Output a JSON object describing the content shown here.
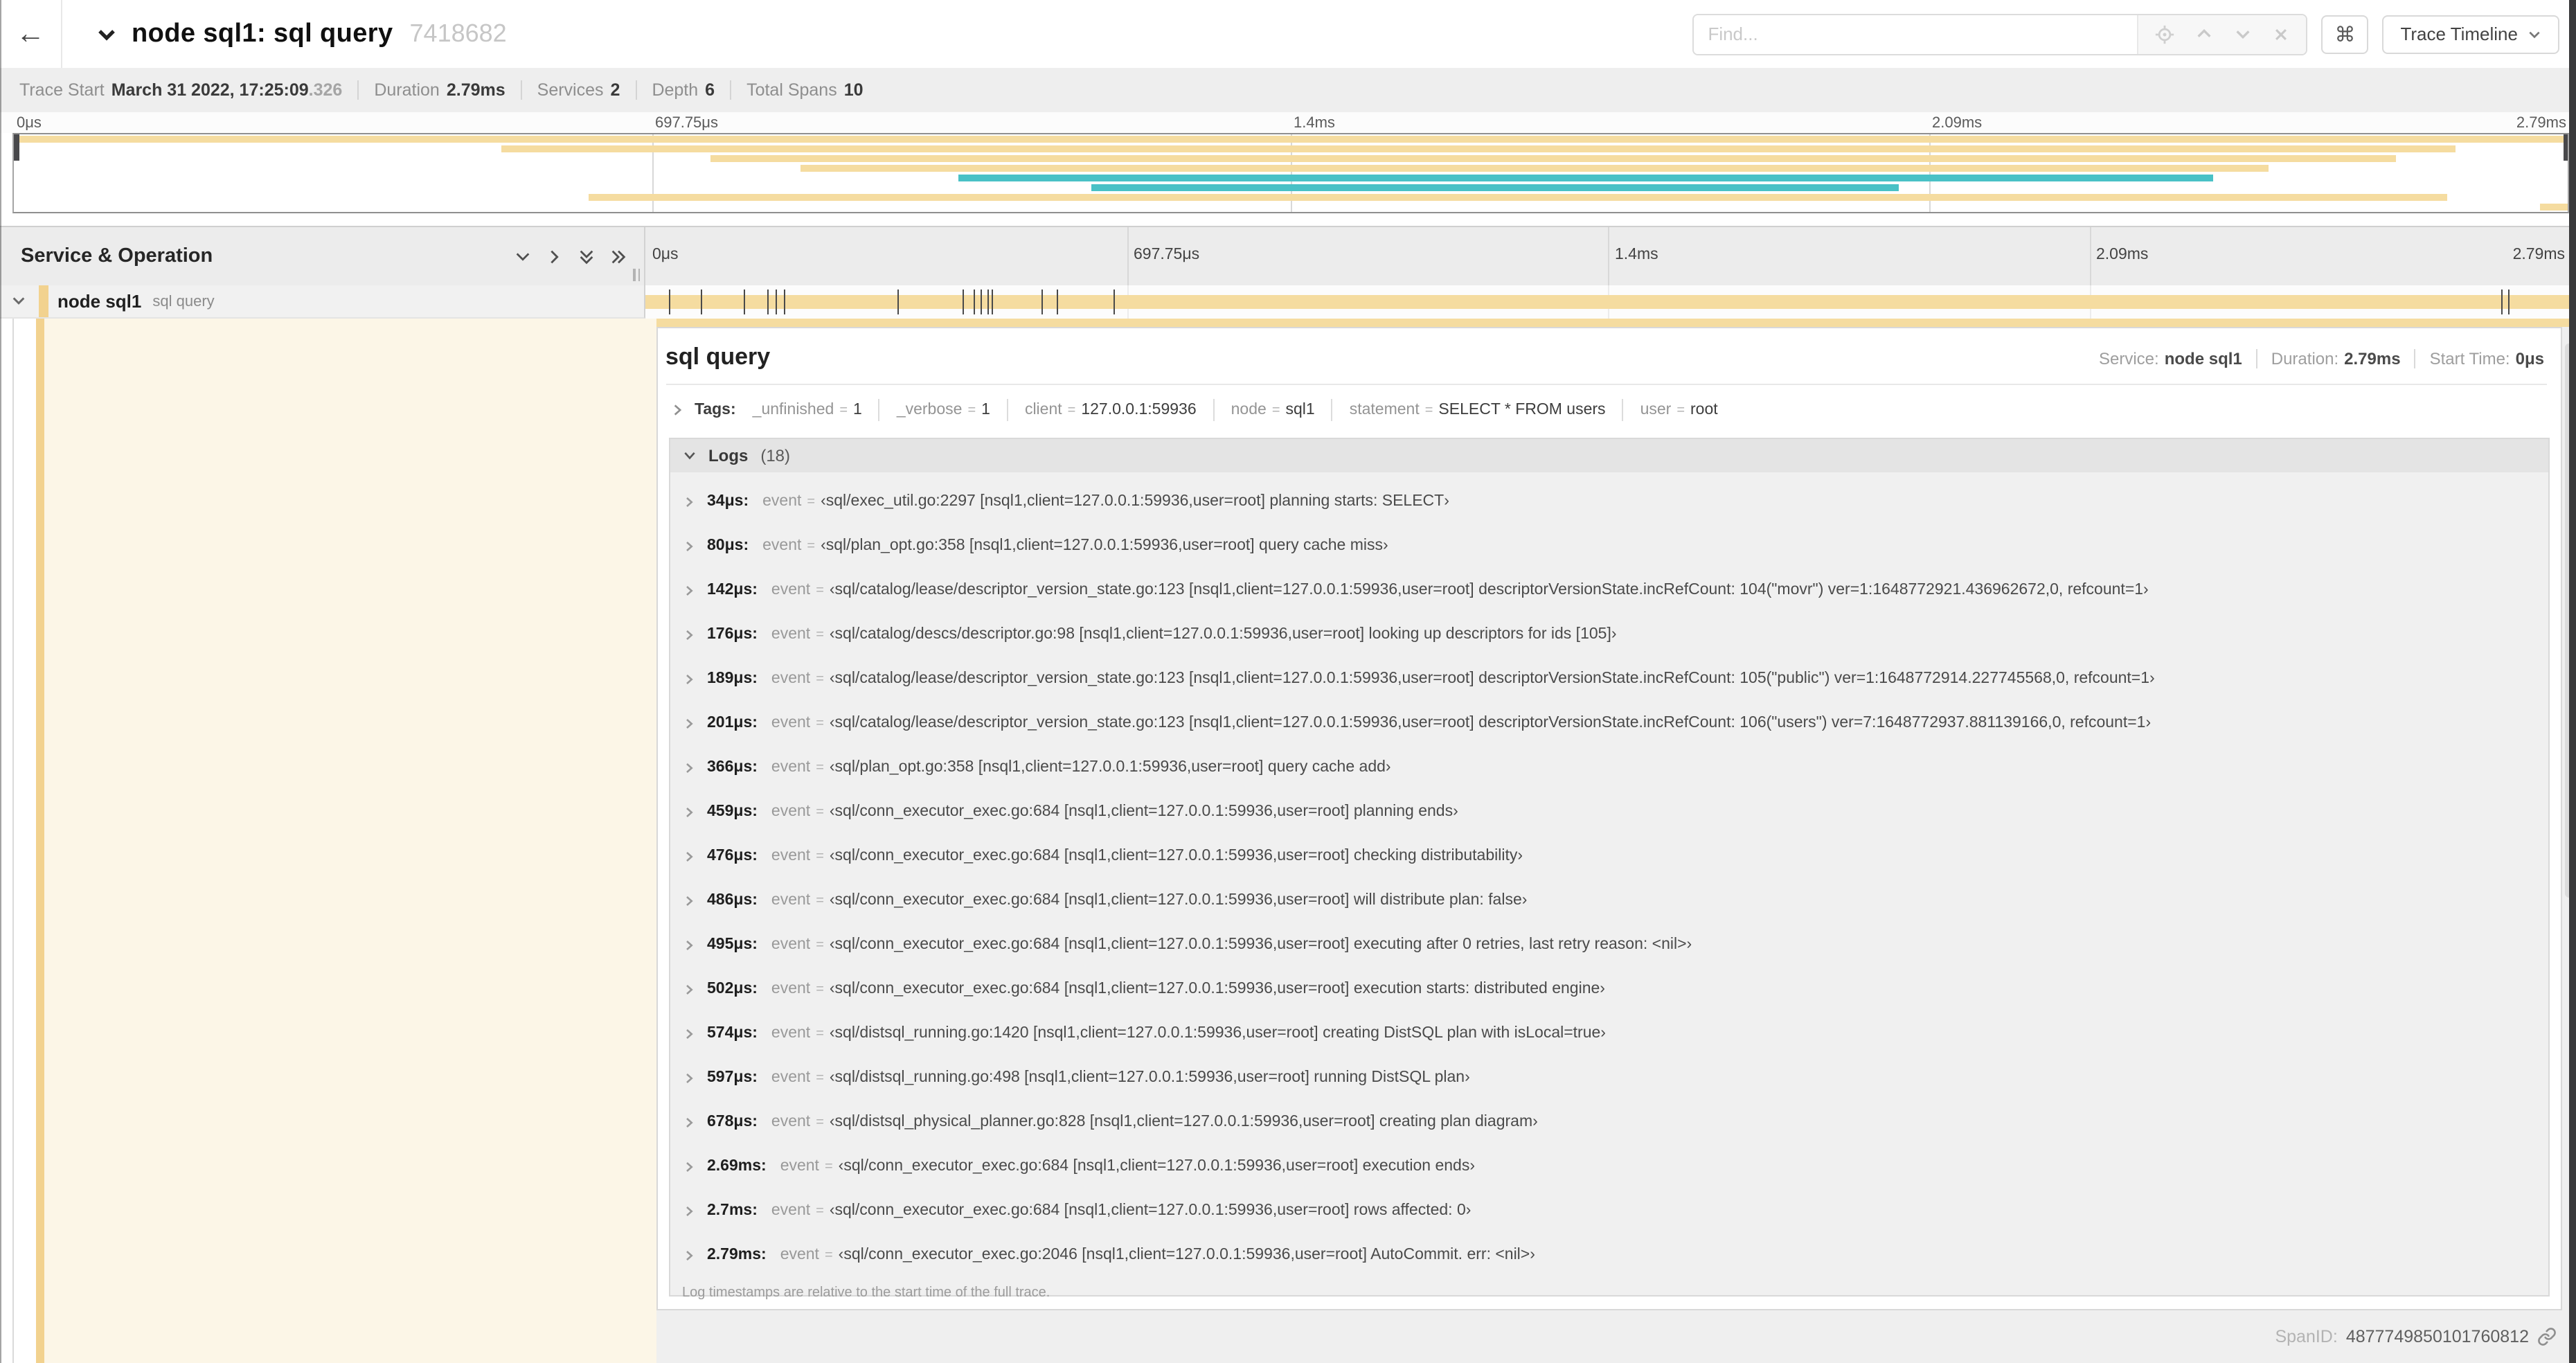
{
  "header": {
    "back_icon": "←",
    "title": "node sql1: sql query",
    "trace_id": "7418682",
    "find_placeholder": "Find...",
    "command_icon": "⌘",
    "view_dropdown": "Trace Timeline"
  },
  "trace_meta": {
    "items": [
      {
        "label": "Trace Start",
        "value": "March 31 2022, 17:25:09",
        "dim": ".326"
      },
      {
        "label": "Duration",
        "value": "2.79ms",
        "dim": ""
      },
      {
        "label": "Services",
        "value": "2",
        "dim": ""
      },
      {
        "label": "Depth",
        "value": "6",
        "dim": ""
      },
      {
        "label": "Total Spans",
        "value": "10",
        "dim": ""
      }
    ]
  },
  "minimap": {
    "ruler_labels": [
      "0μs",
      "697.75μs",
      "1.4ms",
      "2.09ms",
      "2.79ms"
    ],
    "spans": [
      {
        "row": 0,
        "start": 0,
        "end": 100,
        "color": "tan"
      },
      {
        "row": 1,
        "start": 19.1,
        "end": 95.6,
        "color": "tan"
      },
      {
        "row": 2,
        "start": 27.3,
        "end": 93.3,
        "color": "tan"
      },
      {
        "row": 3,
        "start": 30.8,
        "end": 88.3,
        "color": "tan"
      },
      {
        "row": 4,
        "start": 37.0,
        "end": 86.1,
        "color": "teal"
      },
      {
        "row": 5,
        "start": 42.2,
        "end": 73.8,
        "color": "teal"
      },
      {
        "row": 6,
        "start": 22.5,
        "end": 95.3,
        "color": "tan"
      },
      {
        "row": 7,
        "start": 98.9,
        "end": 100,
        "color": "tan"
      }
    ]
  },
  "timeline": {
    "left_header": "Service & Operation",
    "ruler_labels": [
      "0μs",
      "697.75μs",
      "1.4ms",
      "2.09ms",
      "2.79ms"
    ],
    "row": {
      "service": "node sql1",
      "operation": "sql query"
    },
    "duration_us": 2790,
    "tick_times_us": [
      34,
      80,
      142,
      176,
      189,
      201,
      366,
      459,
      476,
      486,
      495,
      502,
      574,
      597,
      678,
      2690,
      2700
    ]
  },
  "detail": {
    "title": "sql query",
    "stats": [
      {
        "label": "Service:",
        "value": "node sql1"
      },
      {
        "label": "Duration:",
        "value": "2.79ms"
      },
      {
        "label": "Start Time:",
        "value": "0μs"
      }
    ],
    "tags_label": "Tags:",
    "tags": [
      {
        "key": "_unfinished",
        "eq": "=",
        "value": "1"
      },
      {
        "key": "_verbose",
        "eq": "=",
        "value": "1"
      },
      {
        "key": "client",
        "eq": "=",
        "value": "127.0.0.1:59936"
      },
      {
        "key": "node",
        "eq": "=",
        "value": "sql1"
      },
      {
        "key": "statement",
        "eq": "=",
        "value": "SELECT * FROM users"
      },
      {
        "key": "user",
        "eq": "=",
        "value": "root"
      }
    ],
    "logs_title": "Logs",
    "logs_count": "(18)",
    "logs": [
      {
        "t": "34μs:",
        "k": "event",
        "eq": "=",
        "v": "‹sql/exec_util.go:2297 [nsql1,client=127.0.0.1:59936,user=root] planning starts: SELECT›"
      },
      {
        "t": "80μs:",
        "k": "event",
        "eq": "=",
        "v": "‹sql/plan_opt.go:358 [nsql1,client=127.0.0.1:59936,user=root] query cache miss›"
      },
      {
        "t": "142μs:",
        "k": "event",
        "eq": "=",
        "v": "‹sql/catalog/lease/descriptor_version_state.go:123 [nsql1,client=127.0.0.1:59936,user=root] descriptorVersionState.incRefCount: 104(\"movr\") ver=1:1648772921.436962672,0, refcount=1›"
      },
      {
        "t": "176μs:",
        "k": "event",
        "eq": "=",
        "v": "‹sql/catalog/descs/descriptor.go:98 [nsql1,client=127.0.0.1:59936,user=root] looking up descriptors for ids [105]›"
      },
      {
        "t": "189μs:",
        "k": "event",
        "eq": "=",
        "v": "‹sql/catalog/lease/descriptor_version_state.go:123 [nsql1,client=127.0.0.1:59936,user=root] descriptorVersionState.incRefCount: 105(\"public\") ver=1:1648772914.227745568,0, refcount=1›"
      },
      {
        "t": "201μs:",
        "k": "event",
        "eq": "=",
        "v": "‹sql/catalog/lease/descriptor_version_state.go:123 [nsql1,client=127.0.0.1:59936,user=root] descriptorVersionState.incRefCount: 106(\"users\") ver=7:1648772937.881139166,0, refcount=1›"
      },
      {
        "t": "366μs:",
        "k": "event",
        "eq": "=",
        "v": "‹sql/plan_opt.go:358 [nsql1,client=127.0.0.1:59936,user=root] query cache add›"
      },
      {
        "t": "459μs:",
        "k": "event",
        "eq": "=",
        "v": "‹sql/conn_executor_exec.go:684 [nsql1,client=127.0.0.1:59936,user=root] planning ends›"
      },
      {
        "t": "476μs:",
        "k": "event",
        "eq": "=",
        "v": "‹sql/conn_executor_exec.go:684 [nsql1,client=127.0.0.1:59936,user=root] checking distributability›"
      },
      {
        "t": "486μs:",
        "k": "event",
        "eq": "=",
        "v": "‹sql/conn_executor_exec.go:684 [nsql1,client=127.0.0.1:59936,user=root] will distribute plan: false›"
      },
      {
        "t": "495μs:",
        "k": "event",
        "eq": "=",
        "v": "‹sql/conn_executor_exec.go:684 [nsql1,client=127.0.0.1:59936,user=root] executing after 0 retries, last retry reason: <nil>›"
      },
      {
        "t": "502μs:",
        "k": "event",
        "eq": "=",
        "v": "‹sql/conn_executor_exec.go:684 [nsql1,client=127.0.0.1:59936,user=root] execution starts: distributed engine›"
      },
      {
        "t": "574μs:",
        "k": "event",
        "eq": "=",
        "v": "‹sql/distsql_running.go:1420 [nsql1,client=127.0.0.1:59936,user=root] creating DistSQL plan with isLocal=true›"
      },
      {
        "t": "597μs:",
        "k": "event",
        "eq": "=",
        "v": "‹sql/distsql_running.go:498 [nsql1,client=127.0.0.1:59936,user=root] running DistSQL plan›"
      },
      {
        "t": "678μs:",
        "k": "event",
        "eq": "=",
        "v": "‹sql/distsql_physical_planner.go:828 [nsql1,client=127.0.0.1:59936,user=root] creating plan diagram›"
      },
      {
        "t": "2.69ms:",
        "k": "event",
        "eq": "=",
        "v": "‹sql/conn_executor_exec.go:684 [nsql1,client=127.0.0.1:59936,user=root] execution ends›"
      },
      {
        "t": "2.7ms:",
        "k": "event",
        "eq": "=",
        "v": "‹sql/conn_executor_exec.go:684 [nsql1,client=127.0.0.1:59936,user=root] rows affected: 0›"
      },
      {
        "t": "2.79ms:",
        "k": "event",
        "eq": "=",
        "v": "‹sql/conn_executor_exec.go:2046 [nsql1,client=127.0.0.1:59936,user=root] AutoCommit. err: <nil>›"
      }
    ],
    "logs_note": "Log timestamps are relative to the start time of the full trace.",
    "spanid_label": "SpanID:",
    "spanid_value": "4877749850101760812"
  },
  "colors": {
    "tan": "#F5DCA0",
    "teal": "#49C1C6",
    "accent": "#F2D28F",
    "cream": "#FCF6E7"
  }
}
